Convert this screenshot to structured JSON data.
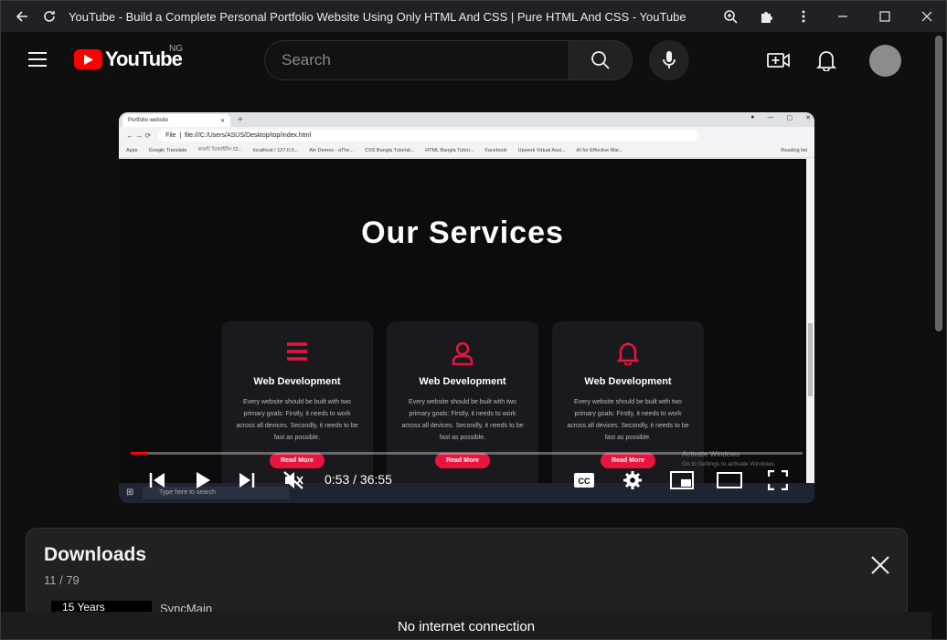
{
  "window": {
    "title": "YouTube - Build a Complete Personal Portfolio Website Using Only HTML And CSS | Pure HTML And CSS - YouTube"
  },
  "header": {
    "logo_text": "YouTube",
    "country_code": "NG",
    "search_placeholder": "Search"
  },
  "video": {
    "inner_browser": {
      "tab_title": "Portfolio website",
      "url": "file:///C:/Users/ASUS/Desktop/top/index.html",
      "file_label": "File",
      "bookmarks": [
        "Apps",
        "Google Translate",
        "কমেন্ট ডিজাইনিং Cl...",
        "localhost / 127.0.0...",
        "Ain Demos - aThe...",
        "CSS Bangla Tutorial...",
        "HTML Bangla Tutori...",
        "Facebook",
        "Upwork Virtual Assi...",
        "AI for Effective Mar..."
      ],
      "reading_list": "Reading list"
    },
    "page": {
      "heading": "Our Services",
      "cards": [
        {
          "icon": "menu-icon",
          "title": "Web Development",
          "text": "Every website should be built with two primary goals: Firstly, it needs to work across all devices. Secondly, it needs to be fast as possible.",
          "button": "Read More"
        },
        {
          "icon": "user-icon",
          "title": "Web Development",
          "text": "Every website should be built with two primary goals: Firstly, it needs to work across all devices. Secondly, it needs to be fast as possible.",
          "button": "Read More"
        },
        {
          "icon": "bell-icon",
          "title": "Web Development",
          "text": "Every website should be built with two primary goals: Firstly, it needs to work across all devices. Secondly, it needs to be fast as possible.",
          "button": "Read More"
        }
      ],
      "activate_line1": "Activate Windows",
      "activate_line2": "Go to Settings to activate Windows.",
      "taskbar_search": "Type here to search"
    },
    "player": {
      "current_time": "0:53",
      "duration": "36:55",
      "time_display": "0:53 / 36:55",
      "progress_fraction": 0.024,
      "muted": true
    }
  },
  "downloads": {
    "title": "Downloads",
    "count": "11 / 79",
    "item_thumb_label": "15 Years",
    "item_title": "SyncMain"
  },
  "status": {
    "message": "No internet connection"
  },
  "colors": {
    "brand_red": "#ff0000",
    "card_button": "#e8163f",
    "background": "#0f0f0f"
  }
}
